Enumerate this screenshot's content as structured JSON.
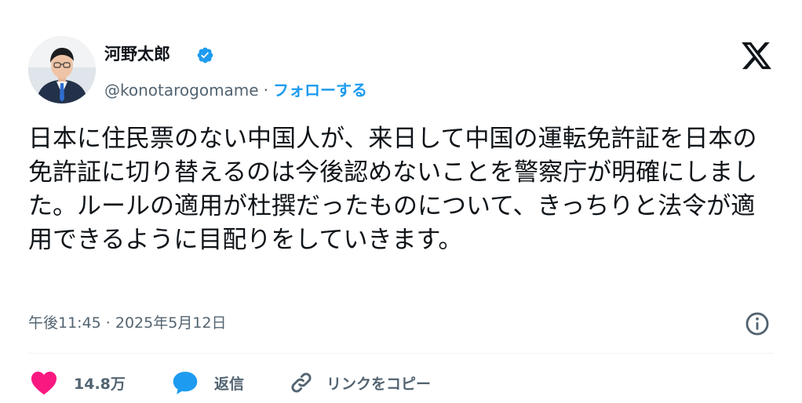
{
  "author": {
    "display_name": "河野太郎",
    "handle": "@konotarogomame",
    "separator": "·",
    "follow_label": "フォローする",
    "verified_icon": "verified-badge-icon",
    "avatar_icon": "profile-photo"
  },
  "platform": {
    "logo_icon": "x-logo-icon"
  },
  "tweet": {
    "text": "日本に住民票のない中国人が、来日して中国の運転免許証を日本の免許証に切り替えるのは今後認めないことを警察庁が明確にしました。ルールの適用が杜撰だったものについて、きっちりと法令が適用できるように目配りをしていきます。",
    "timestamp": "午後11:45 · 2025年5月12日",
    "info_icon": "info-icon"
  },
  "actions": {
    "like": {
      "count": "14.8万",
      "icon": "heart-icon"
    },
    "reply": {
      "label": "返信",
      "icon": "speech-bubble-icon"
    },
    "copy_link": {
      "label": "リンクをコピー",
      "icon": "link-icon"
    }
  },
  "colors": {
    "text": "#0f1419",
    "secondary": "#536471",
    "accent": "#1d9bf0",
    "like": "#f91880",
    "divider": "#eff3f4"
  }
}
